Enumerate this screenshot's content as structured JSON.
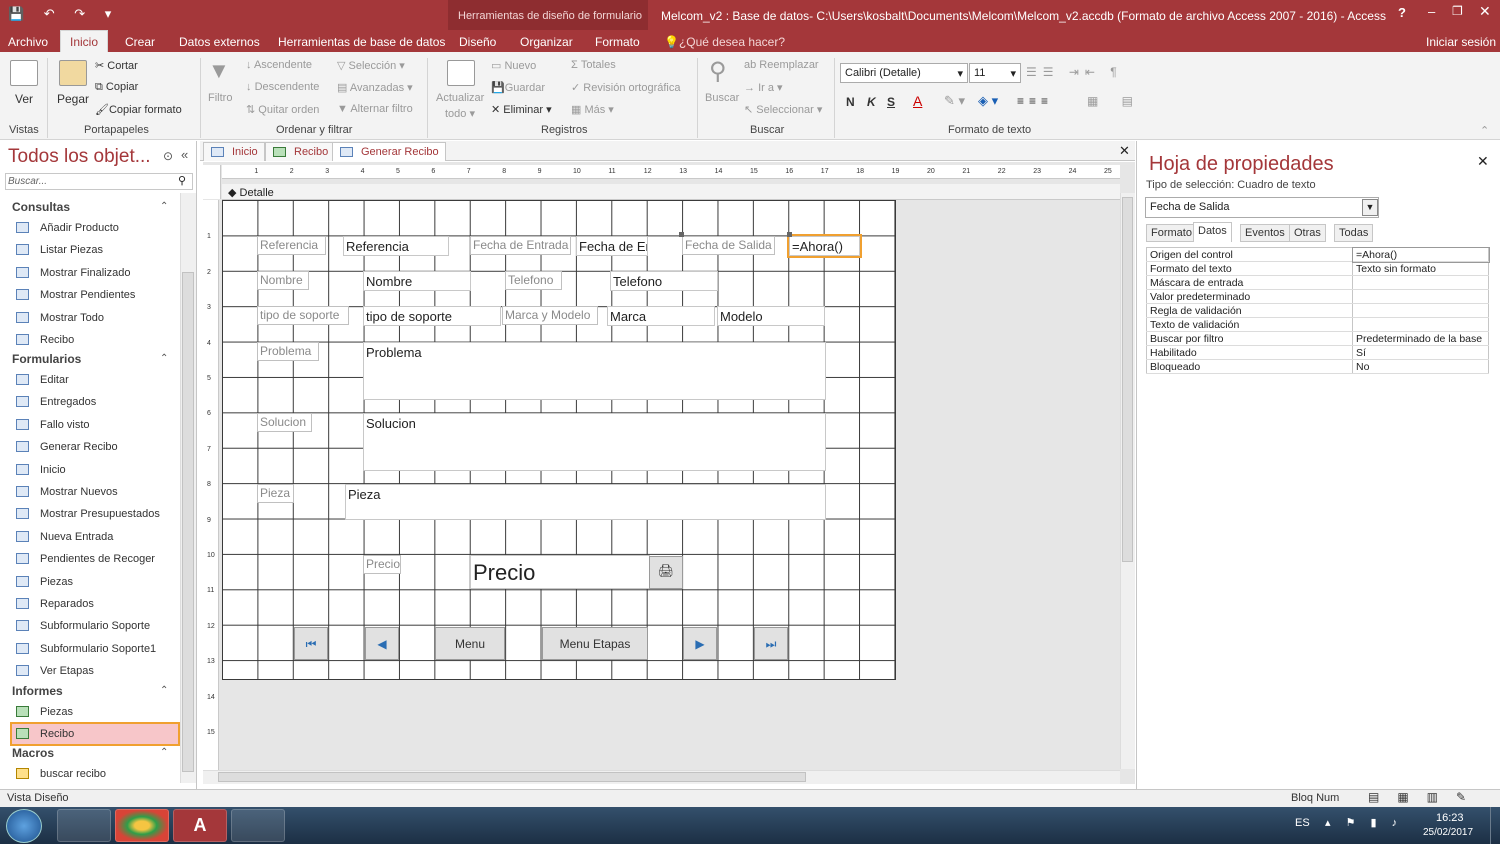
{
  "titlebar": {
    "context_tab": "Herramientas de diseño de formulario",
    "window_title": "Melcom_v2 : Base de datos- C:\\Users\\kosbalt\\Documents\\Melcom\\Melcom_v2.accdb (Formato de archivo Access 2007 - 2016) - Access",
    "help": "?",
    "signin": "Iniciar sesión"
  },
  "ribbon_tabs": [
    "Archivo",
    "Inicio",
    "Crear",
    "Datos externos",
    "Herramientas de base de datos",
    "Diseño",
    "Organizar",
    "Formato"
  ],
  "tell_me": "¿Qué desea hacer?",
  "ribbon": {
    "vistas": {
      "ver": "Ver",
      "group": "Vistas"
    },
    "portapapeles": {
      "pegar": "Pegar",
      "cortar": "Cortar",
      "copiar": "Copiar",
      "copiar_formato": "Copiar formato",
      "group": "Portapapeles"
    },
    "ordenar": {
      "filtro": "Filtro",
      "ascendente": "Ascendente",
      "descendente": "Descendente",
      "quitar_orden": "Quitar orden",
      "seleccion": "Selección",
      "avanzadas": "Avanzadas",
      "alternar": "Alternar filtro",
      "group": "Ordenar y filtrar"
    },
    "registros": {
      "actualizar": "Actualizar",
      "todo": "todo",
      "nuevo": "Nuevo",
      "guardar": "Guardar",
      "eliminar": "Eliminar",
      "totales": "Totales",
      "revision": "Revisión ortográfica",
      "mas": "Más",
      "group": "Registros"
    },
    "buscar": {
      "buscar": "Buscar",
      "reemplazar": "Reemplazar",
      "ir_a": "Ir a",
      "seleccionar": "Seleccionar",
      "group": "Buscar"
    },
    "formato": {
      "font": "Calibri (Detalle)",
      "size": "11",
      "bold": "N",
      "italic": "K",
      "underline": "S",
      "group": "Formato de texto"
    }
  },
  "nav": {
    "title": "Todos los objet...",
    "search_placeholder": "Buscar...",
    "sections": [
      {
        "name": "Consultas",
        "items": [
          "Añadir Producto",
          "Listar Piezas",
          "Mostrar Finalizado",
          "Mostrar Pendientes",
          "Mostrar Todo",
          "Recibo"
        ]
      },
      {
        "name": "Formularios",
        "items": [
          "Editar",
          "Entregados",
          "Fallo visto",
          "Generar Recibo",
          "Inicio",
          "Mostrar Nuevos",
          "Mostrar Presupuestados",
          "Nueva Entrada",
          "Pendientes de Recoger",
          "Piezas",
          "Reparados",
          "Subformulario Soporte",
          "Subformulario Soporte1",
          "Ver Etapas"
        ]
      },
      {
        "name": "Informes",
        "items": [
          "Piezas",
          "Recibo"
        ]
      },
      {
        "name": "Macros",
        "items": [
          "buscar recibo"
        ]
      }
    ]
  },
  "doc_tabs": [
    "Inicio",
    "Recibo",
    "Generar Recibo"
  ],
  "form": {
    "section": "Detalle",
    "labels": {
      "referencia": "Referencia",
      "fecha_entrada": "Fecha de Entrada",
      "fecha_salida": "Fecha de Salida",
      "nombre": "Nombre",
      "telefono": "Telefono",
      "tipo": "tipo de soporte",
      "marca_modelo": "Marca y Modelo",
      "problema": "Problema",
      "solucion": "Solucion",
      "pieza": "Pieza",
      "precio": "Precio"
    },
    "fields": {
      "referencia": "Referencia",
      "fecha_entrada": "Fecha de En",
      "ahora": "=Ahora()",
      "nombre": "Nombre",
      "telefono": "Telefono",
      "tipo": "tipo de soporte",
      "marca": "Marca",
      "modelo": "Modelo",
      "problema": "Problema",
      "solucion": "Solucion",
      "pieza": "Pieza",
      "precio": "Precio"
    },
    "buttons": {
      "menu": "Menu",
      "menu_etapas": "Menu Etapas"
    }
  },
  "props": {
    "title": "Hoja de propiedades",
    "seltype_label": "Tipo de selección:  Cuadro de texto",
    "selected": "Fecha de Salida",
    "tabs": [
      "Formato",
      "Datos",
      "Eventos",
      "Otras",
      "Todas"
    ],
    "rows": [
      [
        "Origen del control",
        "=Ahora()"
      ],
      [
        "Formato del texto",
        "Texto sin formato"
      ],
      [
        "Máscara de entrada",
        ""
      ],
      [
        "Valor predeterminado",
        ""
      ],
      [
        "Regla de validación",
        ""
      ],
      [
        "Texto de validación",
        ""
      ],
      [
        "Buscar por filtro",
        "Predeterminado de la base"
      ],
      [
        "Habilitado",
        "Sí"
      ],
      [
        "Bloqueado",
        "No"
      ]
    ]
  },
  "status": {
    "left": "Vista Diseño",
    "numlock": "Bloq Num"
  },
  "taskbar": {
    "lang": "ES",
    "time": "16:23",
    "date": "25/02/2017"
  },
  "colors": {
    "accent": "#a4373a",
    "selection": "#f0a030"
  }
}
